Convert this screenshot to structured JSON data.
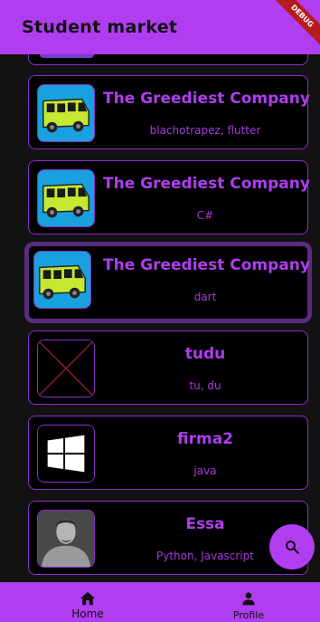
{
  "app": {
    "title": "Student market",
    "debug_label": "DEBUG"
  },
  "companies": [
    {
      "name": "The Greediest Company",
      "tags": "blachotrapez, flutter",
      "logo": "bus-icon"
    },
    {
      "name": "The Greediest Company",
      "tags": "C#",
      "logo": "bus-icon"
    },
    {
      "name": "The Greediest Company",
      "tags": "dart",
      "logo": "bus-icon",
      "selected": true
    },
    {
      "name": "tudu",
      "tags": "tu, du",
      "logo": "broken-image-icon"
    },
    {
      "name": "firma2",
      "tags": "java",
      "logo": "windows-logo-icon"
    },
    {
      "name": "Essa",
      "tags": "Python, Javascript",
      "logo": "person-photo"
    }
  ],
  "fab": {
    "icon": "search-icon"
  },
  "bottom_nav": {
    "items": [
      {
        "label": "Home",
        "icon": "home-icon"
      },
      {
        "label": "Profile",
        "icon": "person-icon"
      }
    ]
  },
  "colors": {
    "accent": "#b03df0",
    "background": "#121212",
    "card": "#000000",
    "selected_border": "#5a2a80"
  }
}
